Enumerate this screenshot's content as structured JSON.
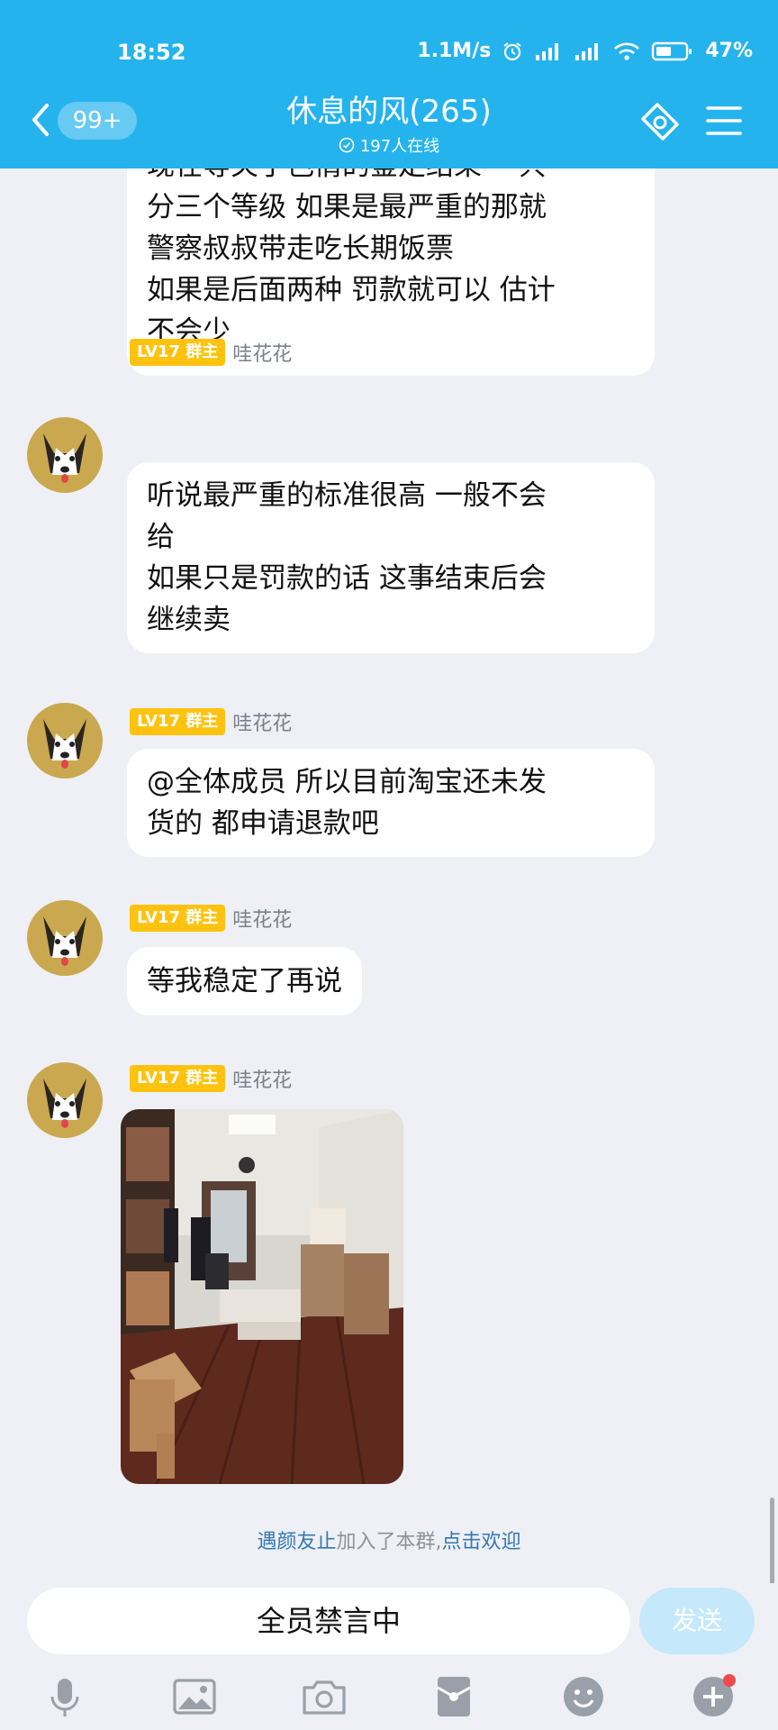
{
  "status_bar": {
    "time": "18:52",
    "net_speed": "1.1M/s",
    "battery": "47%"
  },
  "header": {
    "back_count": "99+",
    "title": "休息的风(265)",
    "online": "197人在线"
  },
  "messages": [
    {
      "lines": [
        "现在等关于色情的鉴定结果 一共",
        "分三个等级 如果是最严重的那就",
        "警察叔叔带走吃长期饭票",
        "如果是后面两种 罚款就可以 估计",
        "不会少"
      ]
    },
    {
      "level": "LV17 群主",
      "sender": "哇花花",
      "lines": [
        "听说最严重的标准很高 一般不会",
        "给",
        "如果只是罚款的话 这事结束后会",
        "继续卖"
      ]
    },
    {
      "level": "LV17 群主",
      "sender": "哇花花",
      "lines": [
        "@全体成员 所以目前淘宝还未发",
        "货的 都申请退款吧"
      ]
    },
    {
      "level": "LV17 群主",
      "sender": "哇花花",
      "lines": [
        "等我稳定了再说"
      ]
    },
    {
      "level": "LV17 群主",
      "sender": "哇花花"
    }
  ],
  "system": {
    "name": "遇颜友止",
    "text": "加入了本群,",
    "action": "点击欢迎"
  },
  "input": {
    "placeholder": "全员禁言中",
    "send_label": "发送"
  },
  "icons": {
    "back": "chevron-left-icon",
    "online": "check-circle-icon",
    "group_share": "ticket-icon",
    "menu": "hamburger-menu-icon",
    "toolbar": [
      "microphone-icon",
      "image-icon",
      "camera-icon",
      "red-packet-icon",
      "emoji-icon",
      "plus-icon"
    ]
  },
  "colors": {
    "header": "#25b3ee",
    "level_badge": "#ffc30f",
    "link": "#3378b5",
    "send_disabled": "#c5e9fb"
  }
}
